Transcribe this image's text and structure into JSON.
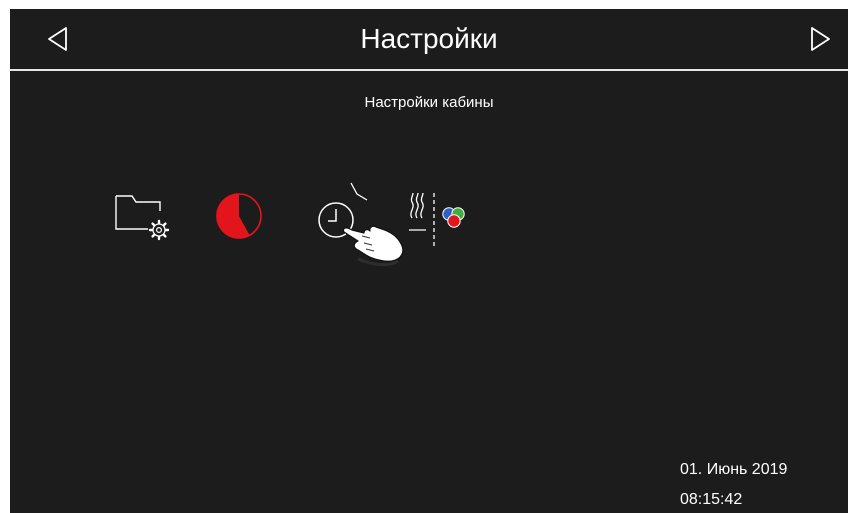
{
  "header": {
    "title": "Настройки",
    "prev_icon": "triangle-left-icon",
    "next_icon": "triangle-right-icon"
  },
  "section": {
    "title": "Настройки кабины"
  },
  "icons": [
    {
      "name": "folder-settings-icon"
    },
    {
      "name": "pie-timer-icon",
      "color": "#e3151c"
    },
    {
      "name": "clock-icon"
    },
    {
      "name": "hand-pointer-icon"
    },
    {
      "name": "steam-color-light-icon",
      "colors": [
        "#2f5fc4",
        "#3fae3c",
        "#e3151c"
      ]
    }
  ],
  "status": {
    "date": "01. Июнь 2019",
    "time": "08:15:42"
  },
  "colors": {
    "background": "#1c1c1c",
    "text": "#ffffff",
    "accent": "#e3151c"
  }
}
